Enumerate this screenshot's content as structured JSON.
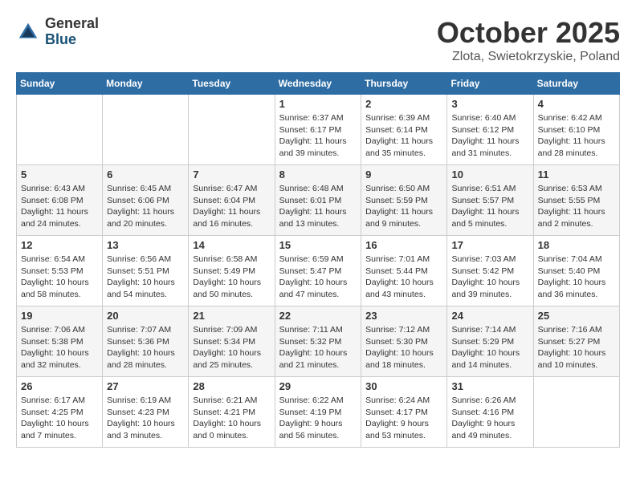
{
  "logo": {
    "general": "General",
    "blue": "Blue"
  },
  "title": "October 2025",
  "location": "Zlota, Swietokrzyskie, Poland",
  "weekdays": [
    "Sunday",
    "Monday",
    "Tuesday",
    "Wednesday",
    "Thursday",
    "Friday",
    "Saturday"
  ],
  "weeks": [
    [
      {
        "day": "",
        "info": ""
      },
      {
        "day": "",
        "info": ""
      },
      {
        "day": "",
        "info": ""
      },
      {
        "day": "1",
        "info": "Sunrise: 6:37 AM\nSunset: 6:17 PM\nDaylight: 11 hours\nand 39 minutes."
      },
      {
        "day": "2",
        "info": "Sunrise: 6:39 AM\nSunset: 6:14 PM\nDaylight: 11 hours\nand 35 minutes."
      },
      {
        "day": "3",
        "info": "Sunrise: 6:40 AM\nSunset: 6:12 PM\nDaylight: 11 hours\nand 31 minutes."
      },
      {
        "day": "4",
        "info": "Sunrise: 6:42 AM\nSunset: 6:10 PM\nDaylight: 11 hours\nand 28 minutes."
      }
    ],
    [
      {
        "day": "5",
        "info": "Sunrise: 6:43 AM\nSunset: 6:08 PM\nDaylight: 11 hours\nand 24 minutes."
      },
      {
        "day": "6",
        "info": "Sunrise: 6:45 AM\nSunset: 6:06 PM\nDaylight: 11 hours\nand 20 minutes."
      },
      {
        "day": "7",
        "info": "Sunrise: 6:47 AM\nSunset: 6:04 PM\nDaylight: 11 hours\nand 16 minutes."
      },
      {
        "day": "8",
        "info": "Sunrise: 6:48 AM\nSunset: 6:01 PM\nDaylight: 11 hours\nand 13 minutes."
      },
      {
        "day": "9",
        "info": "Sunrise: 6:50 AM\nSunset: 5:59 PM\nDaylight: 11 hours\nand 9 minutes."
      },
      {
        "day": "10",
        "info": "Sunrise: 6:51 AM\nSunset: 5:57 PM\nDaylight: 11 hours\nand 5 minutes."
      },
      {
        "day": "11",
        "info": "Sunrise: 6:53 AM\nSunset: 5:55 PM\nDaylight: 11 hours\nand 2 minutes."
      }
    ],
    [
      {
        "day": "12",
        "info": "Sunrise: 6:54 AM\nSunset: 5:53 PM\nDaylight: 10 hours\nand 58 minutes."
      },
      {
        "day": "13",
        "info": "Sunrise: 6:56 AM\nSunset: 5:51 PM\nDaylight: 10 hours\nand 54 minutes."
      },
      {
        "day": "14",
        "info": "Sunrise: 6:58 AM\nSunset: 5:49 PM\nDaylight: 10 hours\nand 50 minutes."
      },
      {
        "day": "15",
        "info": "Sunrise: 6:59 AM\nSunset: 5:47 PM\nDaylight: 10 hours\nand 47 minutes."
      },
      {
        "day": "16",
        "info": "Sunrise: 7:01 AM\nSunset: 5:44 PM\nDaylight: 10 hours\nand 43 minutes."
      },
      {
        "day": "17",
        "info": "Sunrise: 7:03 AM\nSunset: 5:42 PM\nDaylight: 10 hours\nand 39 minutes."
      },
      {
        "day": "18",
        "info": "Sunrise: 7:04 AM\nSunset: 5:40 PM\nDaylight: 10 hours\nand 36 minutes."
      }
    ],
    [
      {
        "day": "19",
        "info": "Sunrise: 7:06 AM\nSunset: 5:38 PM\nDaylight: 10 hours\nand 32 minutes."
      },
      {
        "day": "20",
        "info": "Sunrise: 7:07 AM\nSunset: 5:36 PM\nDaylight: 10 hours\nand 28 minutes."
      },
      {
        "day": "21",
        "info": "Sunrise: 7:09 AM\nSunset: 5:34 PM\nDaylight: 10 hours\nand 25 minutes."
      },
      {
        "day": "22",
        "info": "Sunrise: 7:11 AM\nSunset: 5:32 PM\nDaylight: 10 hours\nand 21 minutes."
      },
      {
        "day": "23",
        "info": "Sunrise: 7:12 AM\nSunset: 5:30 PM\nDaylight: 10 hours\nand 18 minutes."
      },
      {
        "day": "24",
        "info": "Sunrise: 7:14 AM\nSunset: 5:29 PM\nDaylight: 10 hours\nand 14 minutes."
      },
      {
        "day": "25",
        "info": "Sunrise: 7:16 AM\nSunset: 5:27 PM\nDaylight: 10 hours\nand 10 minutes."
      }
    ],
    [
      {
        "day": "26",
        "info": "Sunrise: 6:17 AM\nSunset: 4:25 PM\nDaylight: 10 hours\nand 7 minutes."
      },
      {
        "day": "27",
        "info": "Sunrise: 6:19 AM\nSunset: 4:23 PM\nDaylight: 10 hours\nand 3 minutes."
      },
      {
        "day": "28",
        "info": "Sunrise: 6:21 AM\nSunset: 4:21 PM\nDaylight: 10 hours\nand 0 minutes."
      },
      {
        "day": "29",
        "info": "Sunrise: 6:22 AM\nSunset: 4:19 PM\nDaylight: 9 hours\nand 56 minutes."
      },
      {
        "day": "30",
        "info": "Sunrise: 6:24 AM\nSunset: 4:17 PM\nDaylight: 9 hours\nand 53 minutes."
      },
      {
        "day": "31",
        "info": "Sunrise: 6:26 AM\nSunset: 4:16 PM\nDaylight: 9 hours\nand 49 minutes."
      },
      {
        "day": "",
        "info": ""
      }
    ]
  ]
}
